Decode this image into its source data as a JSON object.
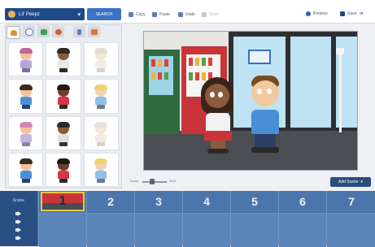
{
  "toolbar": {
    "theme_select": "Lil' Peepz",
    "search_button": "SEARCH",
    "copy": "Copy",
    "paste": "Paste",
    "undo": "Undo",
    "redo": "Redo",
    "preview": "Preview",
    "save": "Save"
  },
  "category_tabs": [
    {
      "icon": "character-icon",
      "color": "#e0903a"
    },
    {
      "icon": "speech-bubble-icon",
      "color": "#5b7cb8"
    },
    {
      "icon": "background-icon",
      "color": "#3aa15a"
    },
    {
      "icon": "prop-icon",
      "color": "#e05a2a"
    },
    {
      "icon": "music-icon",
      "color": "#5b7cb8"
    },
    {
      "icon": "effect-icon",
      "color": "#e07a2a"
    }
  ],
  "stage": {
    "zoom_min_label": "Scale",
    "zoom_max_label": "MAX",
    "add_scene": "Add Scene"
  },
  "timeline": {
    "scene_label": "Scene",
    "scenes": [
      "1",
      "2",
      "3",
      "4",
      "5",
      "6",
      "7"
    ],
    "selected_scene": "1"
  },
  "colors": {
    "toolbar_blue": "#1f4a8a",
    "timeline_blue": "#4b76ab",
    "timeline_dark": "#2a4f83",
    "selection_gold": "#e7c744"
  }
}
